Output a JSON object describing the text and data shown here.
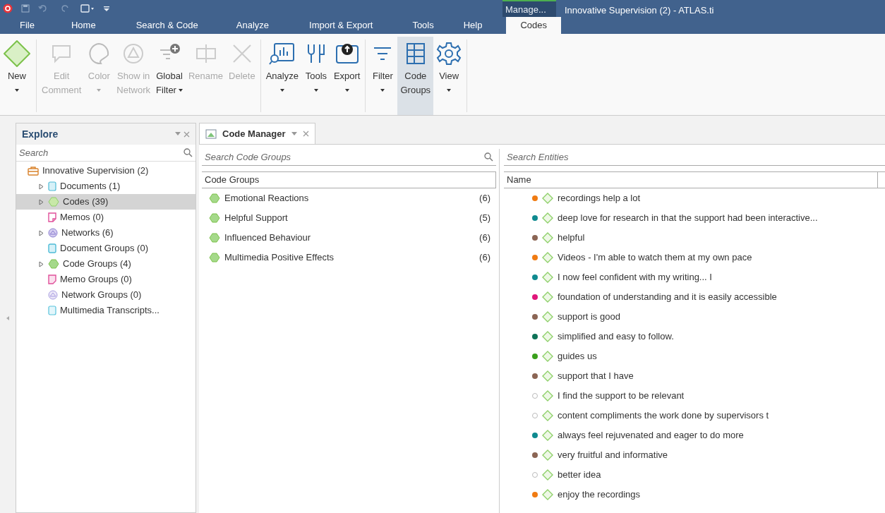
{
  "window": {
    "title": "Innovative Supervision (2) - ATLAS.ti",
    "context_tab": "Manage..."
  },
  "menu_tabs": [
    {
      "label": "File",
      "selected": false
    },
    {
      "label": "Home",
      "selected": false
    },
    {
      "label": "Search & Code",
      "selected": false
    },
    {
      "label": "Analyze",
      "selected": false
    },
    {
      "label": "Import & Export",
      "selected": false
    },
    {
      "label": "Tools",
      "selected": false
    },
    {
      "label": "Help",
      "selected": false
    },
    {
      "label": "Codes",
      "selected": true
    }
  ],
  "ribbon": [
    {
      "lines": [
        "New"
      ],
      "dropdown": true,
      "disabled": false,
      "selected": false
    },
    {
      "lines": [
        "Edit",
        "Comment"
      ],
      "disabled": true,
      "selected": false
    },
    {
      "lines": [
        "Color"
      ],
      "dropdown": true,
      "disabled": true,
      "selected": false
    },
    {
      "lines": [
        "Show in",
        "Network"
      ],
      "disabled": true,
      "selected": false
    },
    {
      "lines": [
        "Global",
        "Filter"
      ],
      "dropdown": true,
      "disabled": false,
      "selected": false
    },
    {
      "lines": [
        "Rename"
      ],
      "disabled": true,
      "selected": false
    },
    {
      "lines": [
        "Delete"
      ],
      "disabled": true,
      "selected": false
    },
    {
      "lines": [
        "Analyze"
      ],
      "dropdown": true,
      "disabled": false,
      "selected": false
    },
    {
      "lines": [
        "Tools"
      ],
      "dropdown": true,
      "disabled": false,
      "selected": false
    },
    {
      "lines": [
        "Export"
      ],
      "dropdown": true,
      "disabled": false,
      "selected": false
    },
    {
      "lines": [
        "Filter"
      ],
      "dropdown": true,
      "disabled": false,
      "selected": false
    },
    {
      "lines": [
        "Code",
        "Groups"
      ],
      "disabled": false,
      "selected": true
    },
    {
      "lines": [
        "View"
      ],
      "dropdown": true,
      "disabled": false,
      "selected": false
    }
  ],
  "explore": {
    "title": "Explore",
    "search": {
      "placeholder": "Search"
    },
    "tree": [
      {
        "kind": "project",
        "label": "Innovative Supervision (2)",
        "selected": false,
        "children": [
          {
            "kind": "documents",
            "label": "Documents (1)",
            "expanded": false,
            "selected": false
          },
          {
            "kind": "codes",
            "label": "Codes (39)",
            "expanded": false,
            "selected": true
          },
          {
            "kind": "memos",
            "label": "Memos (0)",
            "selected": false
          },
          {
            "kind": "networks",
            "label": "Networks (6)",
            "expanded": false,
            "selected": false
          },
          {
            "kind": "document-groups",
            "label": "Document Groups (0)",
            "selected": false
          },
          {
            "kind": "code-groups",
            "label": "Code Groups (4)",
            "expanded": false,
            "selected": false
          },
          {
            "kind": "memo-groups",
            "label": "Memo Groups (0)",
            "selected": false
          },
          {
            "kind": "network-groups",
            "label": "Network Groups (0)",
            "selected": false
          },
          {
            "kind": "transcripts",
            "label": "Multimedia Transcripts...",
            "selected": false
          }
        ]
      }
    ]
  },
  "code_manager": {
    "tab": "Code Manager",
    "groups_search": {
      "placeholder": "Search Code Groups"
    },
    "groups_column": "Code Groups",
    "groups": [
      {
        "name": "Emotional Reactions",
        "count": "(6)"
      },
      {
        "name": "Helpful Support",
        "count": "(5)"
      },
      {
        "name": "Influenced Behaviour",
        "count": "(6)"
      },
      {
        "name": "Multimedia Positive Effects",
        "count": "(6)"
      }
    ],
    "entities_search": {
      "placeholder": "Search Entities"
    },
    "entities_column": "Name",
    "entities": [
      {
        "name": "recordings help a lot",
        "color": "#f07b12"
      },
      {
        "name": "deep love for research in that the support had been interactive...",
        "color": "#0f8a8f"
      },
      {
        "name": "helpful",
        "color": "#8b6554"
      },
      {
        "name": "Videos - I'm able to watch them at my own pace",
        "color": "#f07b12"
      },
      {
        "name": "I now feel confident with my writing... I",
        "color": "#0f8a8f"
      },
      {
        "name": "foundation of understanding and it is easily accessible",
        "color": "#e0177a"
      },
      {
        "name": "support is good",
        "color": "#8b6554"
      },
      {
        "name": "simplified and easy to follow.",
        "color": "#0e7358"
      },
      {
        "name": "guides us",
        "color": "#3aa01c"
      },
      {
        "name": "support that I have",
        "color": "#8b6554"
      },
      {
        "name": "I find the support to be relevant"
      },
      {
        "name": "content compliments the work done by supervisors t"
      },
      {
        "name": "always feel rejuvenated and eager to do more",
        "color": "#0f8a8f"
      },
      {
        "name": "very fruitful and informative",
        "color": "#8b6554"
      },
      {
        "name": "better idea"
      },
      {
        "name": "enjoy the recordings",
        "color": "#f07b12"
      }
    ]
  }
}
